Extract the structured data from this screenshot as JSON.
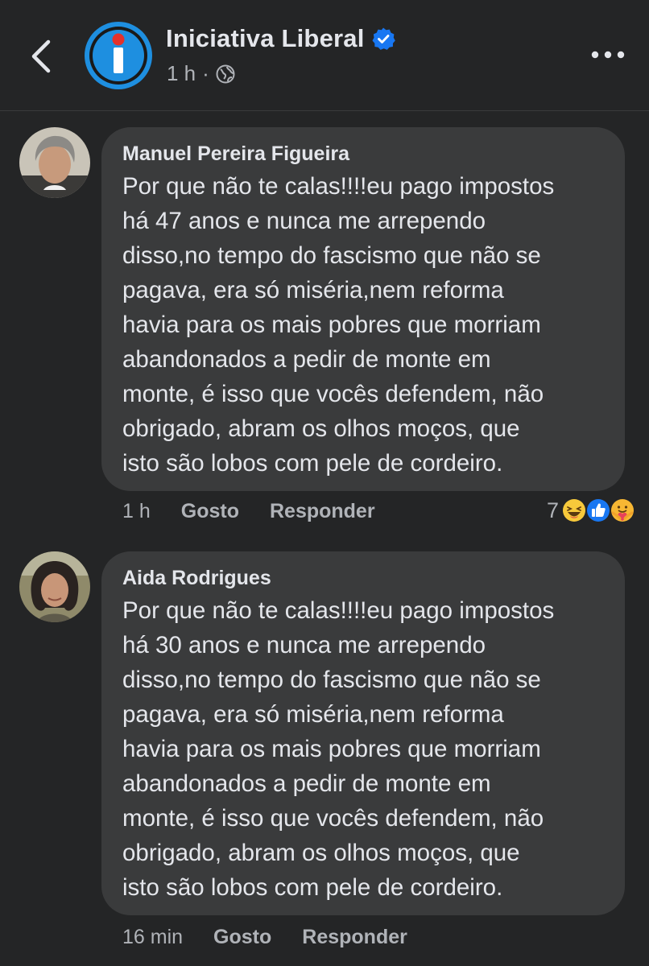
{
  "header": {
    "page_name": "Iniciativa Liberal",
    "time": "1 h",
    "separator": "·",
    "back_icon": "chevron-left-icon",
    "more_icon": "more-horizontal-icon",
    "verified_icon": "verified-badge-icon",
    "privacy_icon": "globe-icon",
    "brand_color": "#1e8fe0"
  },
  "comments": [
    {
      "author": "Manuel Pereira Figueira",
      "text": "Por que não te calas!!!!eu pago impostos\nhá 47 anos e nunca me arrependo\ndisso,no tempo do fascismo que não se\npagava, era só miséria,nem reforma\nhavia para os mais pobres que morriam\nabandonados a pedir de monte em\nmonte, é isso que vocês defendem, não\nobrigado, abram os olhos moços, que\nisto são lobos com pele de cordeiro.",
      "time": "1 h",
      "like_label": "Gosto",
      "reply_label": "Responder",
      "reaction_count": "7",
      "reactions": [
        "haha-icon",
        "like-icon",
        "care-icon"
      ]
    },
    {
      "author": "Aida Rodrigues",
      "text": "Por que não te calas!!!!eu pago impostos\nhá 30 anos e nunca me arrependo\ndisso,no tempo do fascismo que não se\npagava, era só miséria,nem reforma\nhavia para os mais pobres que morriam\nabandonados a pedir de monte em\nmonte, é isso que vocês defendem, não\nobrigado, abram os olhos moços, que\nisto são lobos com pele de cordeiro.",
      "time": "16 min",
      "like_label": "Gosto",
      "reply_label": "Responder"
    }
  ],
  "colors": {
    "background": "#242526",
    "bubble": "#3a3b3c",
    "primary_text": "#e4e6eb",
    "secondary_text": "#b0b3b8",
    "like_blue": "#1877f2",
    "haha_yellow": "#f7c93b"
  }
}
